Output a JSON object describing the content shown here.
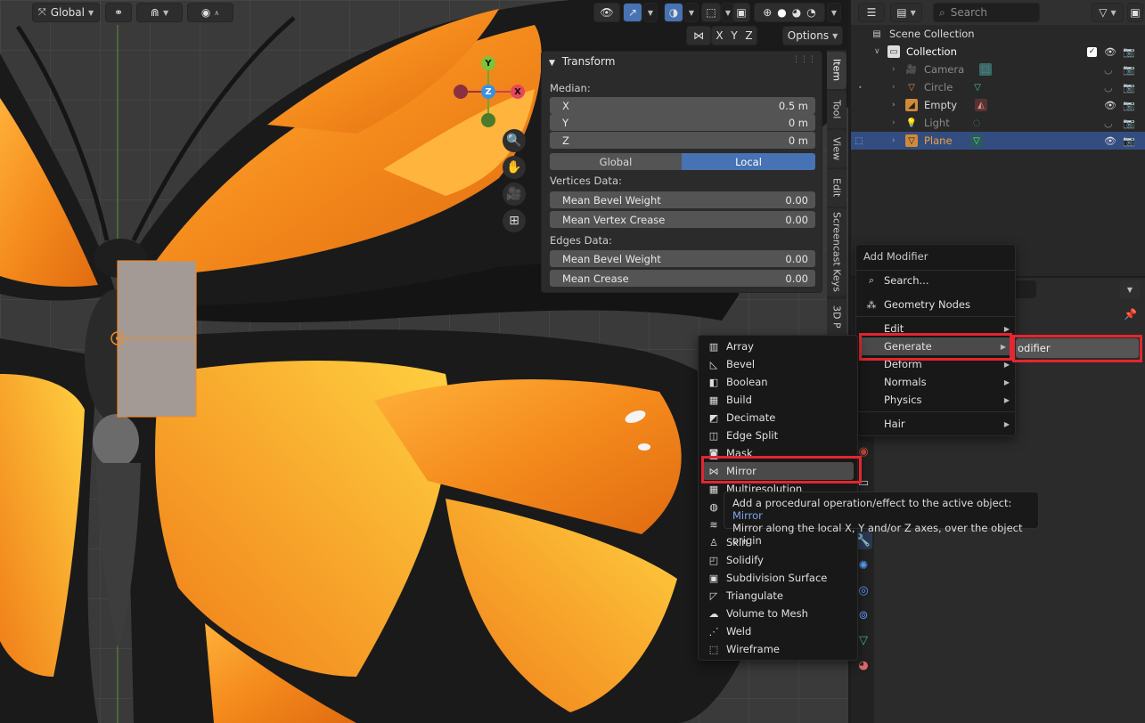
{
  "viewport_header": {
    "orientation": "Global",
    "options": "Options",
    "axes": [
      "X",
      "Y",
      "Z"
    ]
  },
  "gizmo": {
    "x": "X",
    "y": "Y",
    "z": "Z"
  },
  "side_tabs": [
    "Item",
    "Tool",
    "View",
    "Edit",
    "Screencast Keys",
    "3D P"
  ],
  "transform": {
    "title": "Transform",
    "median_label": "Median:",
    "fields": [
      {
        "label": "X",
        "value": "0.5 m"
      },
      {
        "label": "Y",
        "value": "0 m"
      },
      {
        "label": "Z",
        "value": "0 m"
      }
    ],
    "space_global": "Global",
    "space_local": "Local",
    "vertices_label": "Vertices Data:",
    "vertices": [
      {
        "label": "Mean Bevel Weight",
        "value": "0.00"
      },
      {
        "label": "Mean Vertex Crease",
        "value": "0.00"
      }
    ],
    "edges_label": "Edges Data:",
    "edges": [
      {
        "label": "Mean Bevel Weight",
        "value": "0.00"
      },
      {
        "label": "Mean Crease",
        "value": "0.00"
      }
    ]
  },
  "outliner": {
    "search_placeholder": "Search",
    "scene_collection": "Scene Collection",
    "collection": "Collection",
    "items": [
      {
        "name": "Camera"
      },
      {
        "name": "Circle"
      },
      {
        "name": "Empty"
      },
      {
        "name": "Light"
      },
      {
        "name": "Plane"
      }
    ]
  },
  "add_modifier_menu": {
    "title": "Add Modifier",
    "search": "Search...",
    "geometry_nodes": "Geometry Nodes",
    "categories": [
      "Edit",
      "Generate",
      "Deform",
      "Normals",
      "Physics",
      "Hair"
    ],
    "submenu_partial": "odifier"
  },
  "generate_menu": {
    "items": [
      "Array",
      "Bevel",
      "Boolean",
      "Build",
      "Decimate",
      "Edge Split",
      "Mask",
      "Mirror",
      "Multiresolution",
      "Skin",
      "Solidify",
      "Subdivision Surface",
      "Triangulate",
      "Volume to Mesh",
      "Weld",
      "Wireframe"
    ]
  },
  "tooltip": {
    "line1_prefix": "Add a procedural operation/effect to the active object: ",
    "line1_accent": "Mirror",
    "line2": "Mirror along the local X, Y and/or Z axes, over the object origin"
  },
  "colors": {
    "highlight_red": "#e3262f",
    "selection_blue": "#4772b3",
    "wing_orange": "#f08a1c"
  }
}
